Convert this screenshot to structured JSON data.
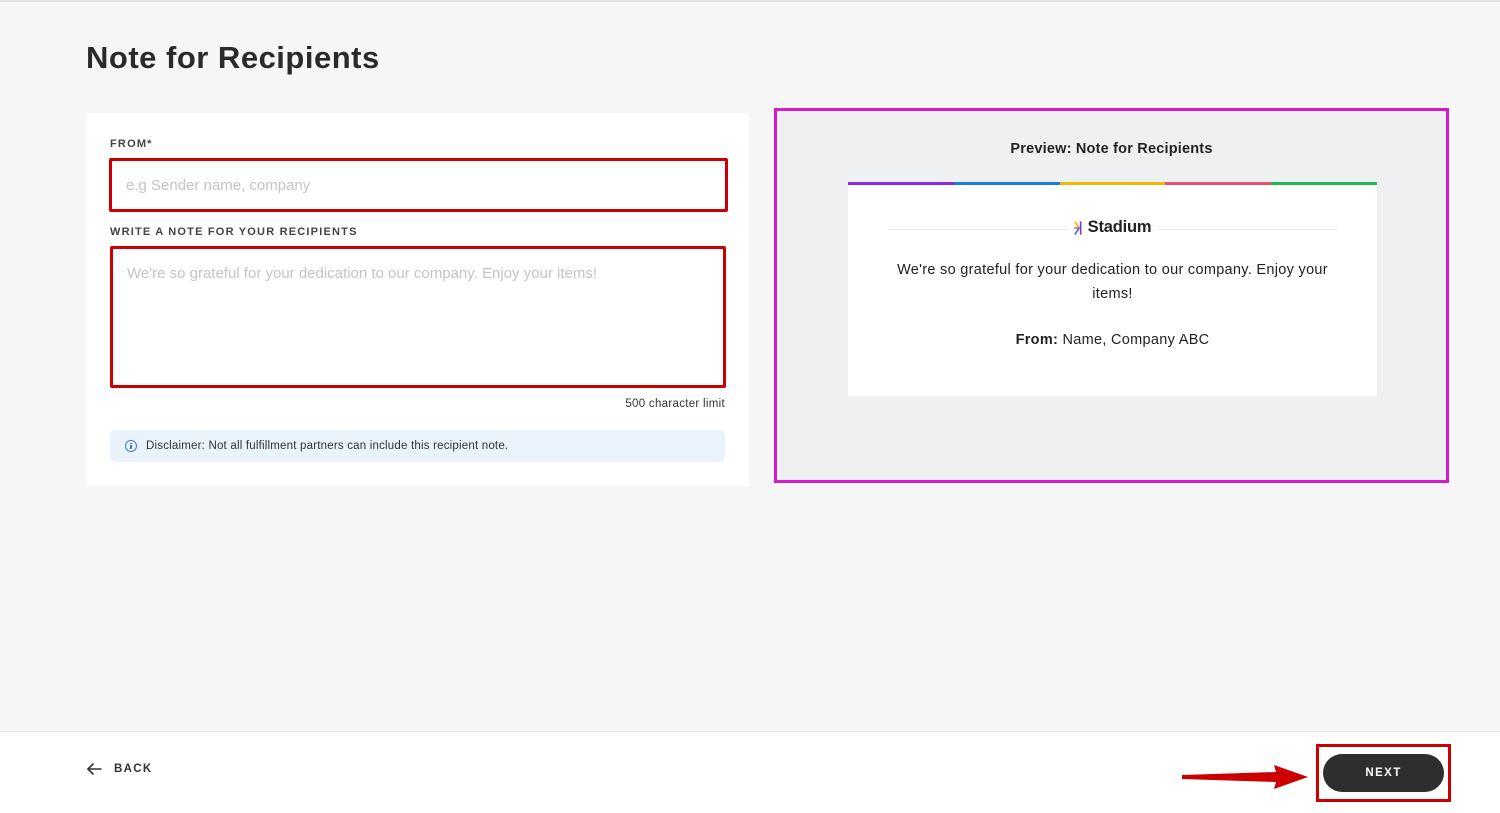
{
  "page": {
    "title": "Note for Recipients"
  },
  "form": {
    "from_label": "FROM*",
    "from_placeholder": "e.g Sender name, company",
    "from_value": "",
    "note_label": "WRITE A NOTE FOR YOUR RECIPIENTS",
    "note_placeholder": "We're so grateful for your dedication to our company. Enjoy your items!",
    "note_value": "",
    "char_limit": "500 character limit",
    "disclaimer_icon": "info-icon",
    "disclaimer": "Disclaimer: Not all fulfillment partners can include this recipient note."
  },
  "preview": {
    "title": "Preview: Note for Recipients",
    "brand_name": "Stadium",
    "brand_icon": "stadium-logo-icon",
    "message": "We're so grateful for your dedication to our company. Enjoy your items!",
    "from_label": "From:",
    "from_value": "Name, Company ABC",
    "accent_colors": [
      "#8a2be2",
      "#1e7be3",
      "#f5b800",
      "#e8506e",
      "#1db954"
    ]
  },
  "footer": {
    "back_icon": "arrow-left-icon",
    "back_label": "BACK",
    "next_label": "NEXT"
  },
  "annotations": {
    "highlight_color_inputs": "#cc0000",
    "highlight_color_preview": "#d51bc8",
    "pointer_arrow_color": "#cc0000"
  }
}
